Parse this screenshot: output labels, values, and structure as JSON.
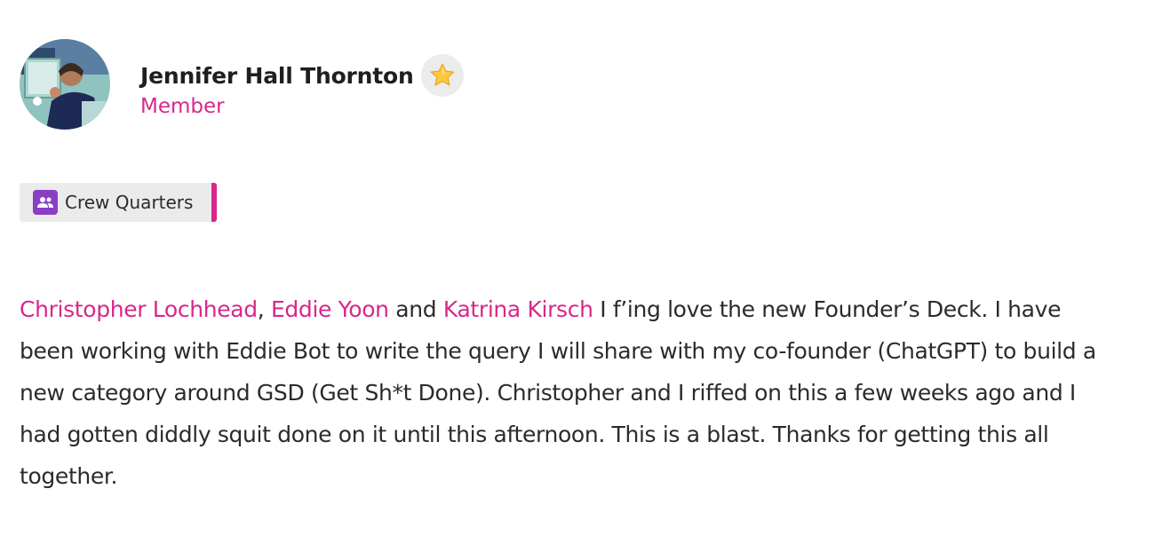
{
  "author": {
    "name": "Jennifer Hall Thornton",
    "role": "Member",
    "avatar_icon": "user-photo-avatar",
    "badge_icon": "star-icon"
  },
  "space": {
    "label": "Crew Quarters",
    "icon": "group-icon",
    "icon_color": "#8a3ec6",
    "accent_color": "#d8288a"
  },
  "post": {
    "mentions": [
      "Christopher Lochhead",
      "Eddie Yoon",
      "Katrina Kirsch"
    ],
    "sep_comma": ", ",
    "sep_and": " and ",
    "text": " I f’ing love the new Founder’s Deck. I have been working with Eddie Bot to write the query I will share with my co-founder (ChatGPT) to build a new category around GSD (Get Sh*t Done). Christopher and I riffed on this a few weeks ago and I had gotten diddly squit done on it until this afternoon. This is a blast. Thanks for getting this all together."
  },
  "colors": {
    "accent": "#d8288a",
    "text": "#2b2b2b",
    "chip_bg": "#ebebeb"
  }
}
